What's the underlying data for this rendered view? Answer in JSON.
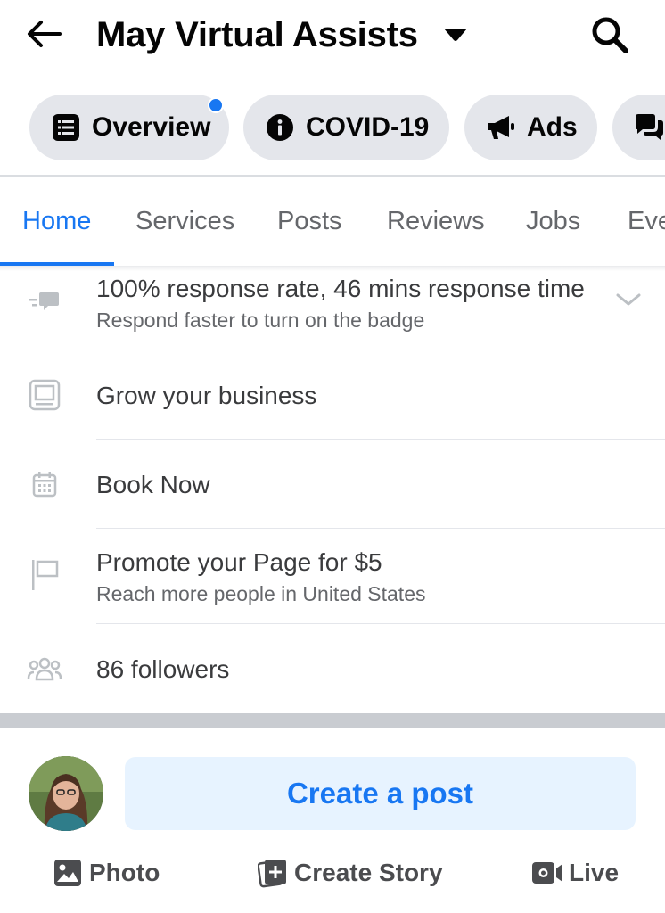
{
  "header": {
    "title": "May Virtual Assists"
  },
  "chips": [
    {
      "label": "Overview",
      "icon": "list-icon",
      "notification": true
    },
    {
      "label": "COVID-19",
      "icon": "info-icon"
    },
    {
      "label": "Ads",
      "icon": "megaphone-icon"
    },
    {
      "label": "",
      "icon": "chat-bubbles-icon"
    }
  ],
  "tabs": [
    {
      "label": "Home",
      "active": true
    },
    {
      "label": "Services"
    },
    {
      "label": "Posts"
    },
    {
      "label": "Reviews"
    },
    {
      "label": "Jobs"
    },
    {
      "label": "Eve"
    }
  ],
  "info_rows": [
    {
      "icon": "response-chat-icon",
      "title": "100% response rate, 46 mins response time",
      "subtitle": "Respond faster to turn on the badge",
      "expandable": true
    },
    {
      "icon": "monitor-icon",
      "title": "Grow your business"
    },
    {
      "icon": "calendar-icon",
      "title": "Book Now"
    },
    {
      "icon": "flag-icon",
      "title": "Promote your Page for $5",
      "subtitle": "Reach more people in United States"
    },
    {
      "icon": "people-icon",
      "title": "86 followers"
    }
  ],
  "composer": {
    "create_post_label": "Create a post",
    "actions": [
      {
        "label": "Photo",
        "icon": "photo-icon"
      },
      {
        "label": "Create Story",
        "icon": "story-plus-icon"
      },
      {
        "label": "Live",
        "icon": "video-camera-icon"
      }
    ]
  },
  "colors": {
    "accent": "#1877f2",
    "chip_bg": "#e4e6eb",
    "create_post_bg": "#e7f3ff",
    "secondary_text": "#65676b"
  }
}
